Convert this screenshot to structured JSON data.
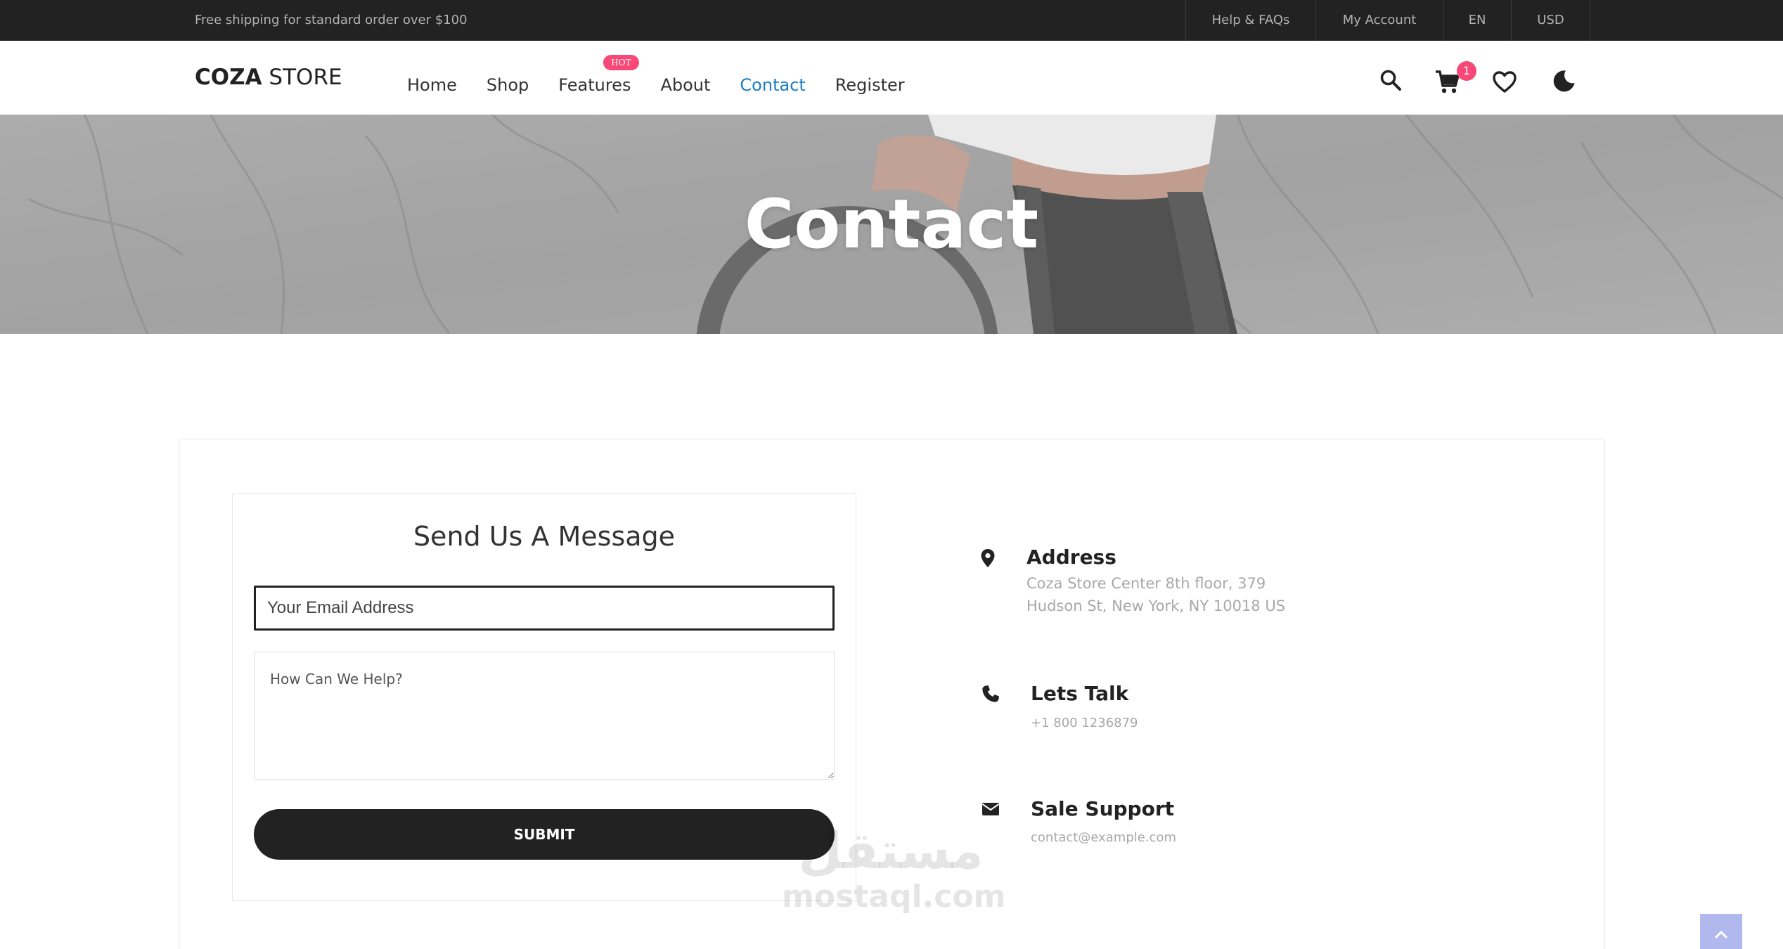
{
  "topbar": {
    "shipping_text": "Free shipping for standard order over $100",
    "links": [
      "Help & FAQs",
      "My Account",
      "EN",
      "USD"
    ]
  },
  "header": {
    "logo_bold": "COZA",
    "logo_thin": " STORE",
    "nav": [
      {
        "label": "Home",
        "active": false
      },
      {
        "label": "Shop",
        "active": false
      },
      {
        "label": "Features",
        "active": false,
        "badge": "HOT"
      },
      {
        "label": "About",
        "active": false
      },
      {
        "label": "Contact",
        "active": true
      },
      {
        "label": "Register",
        "active": false
      }
    ],
    "cart_count": "1",
    "icons": [
      "search-icon",
      "cart-icon",
      "heart-icon",
      "moon-icon"
    ]
  },
  "banner": {
    "title": "Contact"
  },
  "form": {
    "title": "Send Us A Message",
    "email_placeholder": "Your Email Address",
    "message_placeholder": "How Can We Help?",
    "submit_label": "SUBMIT"
  },
  "info": {
    "address": {
      "title": "Address",
      "line1": "Coza Store Center 8th floor, 379",
      "line2": "Hudson St, New York, NY 10018 US"
    },
    "talk": {
      "title": "Lets Talk",
      "phone": "+1 800 1236879"
    },
    "support": {
      "title": "Sale Support",
      "email": "contact@example.com"
    }
  },
  "watermark": {
    "arabic": "مستقل",
    "latin": "mostaql.com"
  },
  "colors": {
    "accent": "#1a7ec4",
    "hot_badge": "#f74877",
    "dark": "#222222",
    "muted": "#a8a8a8"
  }
}
